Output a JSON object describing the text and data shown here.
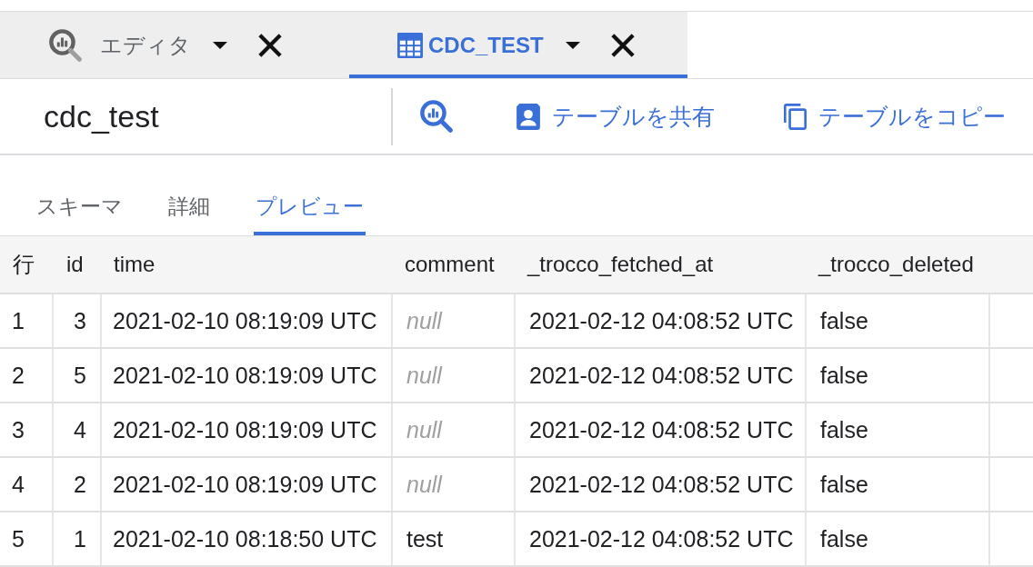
{
  "tabs": [
    {
      "kind": "editor",
      "label": "エディタ",
      "selected": false
    },
    {
      "kind": "table",
      "label": "CDC_TEST",
      "selected": true
    }
  ],
  "toolbar": {
    "title": "cdc_test",
    "actions": [
      {
        "kind": "query"
      },
      {
        "kind": "share",
        "label": "テーブルを共有"
      },
      {
        "kind": "copy",
        "label": "テーブルをコピー"
      }
    ]
  },
  "subtabs": [
    {
      "label": "スキーマ",
      "selected": false
    },
    {
      "label": "詳細",
      "selected": false
    },
    {
      "label": "プレビュー",
      "selected": true
    }
  ],
  "table": {
    "columns": [
      "行",
      "id",
      "time",
      "comment",
      "_trocco_fetched_at",
      "_trocco_deleted"
    ],
    "rows": [
      {
        "cells": [
          "1",
          "3",
          "2021-02-10 08:19:09 UTC",
          "null",
          "2021-02-12 04:08:52 UTC",
          "false"
        ],
        "comment_null": true
      },
      {
        "cells": [
          "2",
          "5",
          "2021-02-10 08:19:09 UTC",
          "null",
          "2021-02-12 04:08:52 UTC",
          "false"
        ],
        "comment_null": true
      },
      {
        "cells": [
          "3",
          "4",
          "2021-02-10 08:19:09 UTC",
          "null",
          "2021-02-12 04:08:52 UTC",
          "false"
        ],
        "comment_null": true
      },
      {
        "cells": [
          "4",
          "2",
          "2021-02-10 08:19:09 UTC",
          "null",
          "2021-02-12 04:08:52 UTC",
          "false"
        ],
        "comment_null": true
      },
      {
        "cells": [
          "5",
          "1",
          "2021-02-10 08:18:50 UTC",
          "test",
          "2021-02-12 04:08:52 UTC",
          "false"
        ],
        "comment_null": false
      }
    ]
  }
}
